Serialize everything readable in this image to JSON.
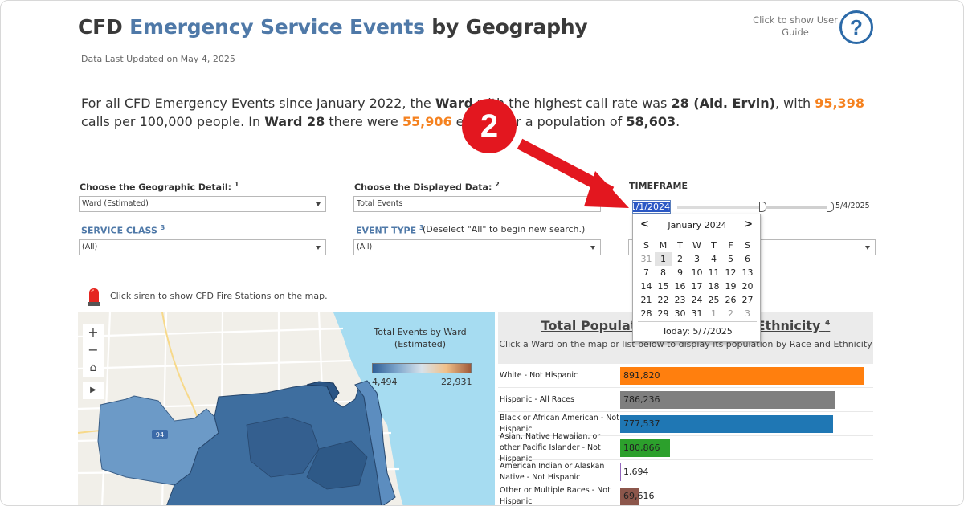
{
  "header": {
    "title_part1": "CFD ",
    "title_part2": "Emergency Service Events",
    "title_part3": " by Geography",
    "updated": "Data Last Updated on May 4, 2025",
    "guide_text": "Click to show User Guide",
    "guide_icon": "help-question-icon",
    "guide_symbol": "?"
  },
  "summary": {
    "p1": "For all CFD Emergency Events since January 2022, the ",
    "geo": "Ward",
    "p2": " with the highest call rate was ",
    "top": "28 (Ald. Ervin)",
    "p3": ", with ",
    "rate": "95,398",
    "p4": " calls per 100,000 people. In ",
    "geo2": "Ward 28",
    "p5": "  there were ",
    "events": "55,906",
    "p6": " events for a population of ",
    "population": "58,603",
    "p7": "."
  },
  "controls": {
    "geo_label": "Choose the Geographic Detail:",
    "geo_sup": "1",
    "geo_value": "Ward (Estimated)",
    "data_label": "Choose the Displayed Data:",
    "data_sup": "2",
    "data_value": "Total Events",
    "timeframe_label": "TIMEFRAME",
    "start_date": "1/1/2024",
    "end_date": "5/4/2025",
    "service_label": "SERVICE CLASS",
    "service_sup": "3",
    "service_value": "(All)",
    "event_label": "EVENT TYPE",
    "event_sup": "3",
    "event_note": "(Deselect \"All\" to begin new search.)",
    "event_value": "(All)"
  },
  "calendar": {
    "month": "January 2024",
    "prev": "<",
    "next": ">",
    "weekdays": [
      "S",
      "M",
      "T",
      "W",
      "T",
      "F",
      "S"
    ],
    "days": [
      "31",
      "1",
      "2",
      "3",
      "4",
      "5",
      "6",
      "7",
      "8",
      "9",
      "10",
      "11",
      "12",
      "13",
      "14",
      "15",
      "16",
      "17",
      "18",
      "19",
      "20",
      "21",
      "22",
      "23",
      "24",
      "25",
      "26",
      "27",
      "28",
      "29",
      "30",
      "31",
      "1",
      "2",
      "3"
    ],
    "today": "Today:  5/7/2025"
  },
  "annotation": {
    "step": "2"
  },
  "map": {
    "siren_text": "Click siren to show CFD Fire Stations on the map.",
    "zoom_in": "+",
    "zoom_out": "−",
    "home": "⌂",
    "play": "▶",
    "legend_title": "Total Events by Ward (Estimated)",
    "legend_min": "4,494",
    "legend_max": "22,931",
    "road_badge": "94"
  },
  "population": {
    "title": "Total Population by Race and Ethnicity",
    "title_sup": "4",
    "subtitle": "Click a Ward on the map or list below to display its population by Race and Ethnicity",
    "rows": [
      {
        "label": "White - Not Hispanic",
        "value": "891,820",
        "num": 891820,
        "color": "#ff7f0e"
      },
      {
        "label": "Hispanic - All Races",
        "value": "786,236",
        "num": 786236,
        "color": "#7f7f7f"
      },
      {
        "label": "Black or African American - Not Hispanic",
        "value": "777,537",
        "num": 777537,
        "color": "#1f77b4"
      },
      {
        "label": "Asian, Native Hawaiian, or other Pacific Islander - Not Hispanic",
        "value": "180,866",
        "num": 180866,
        "color": "#2ca02c"
      },
      {
        "label": "American Indian or Alaskan Native - Not Hispanic",
        "value": "1,694",
        "num": 1694,
        "color": "#9467bd"
      },
      {
        "label": "Other or Multiple Races - Not Hispanic",
        "value": "69,616",
        "num": 69616,
        "color": "#8c564b"
      }
    ]
  }
}
